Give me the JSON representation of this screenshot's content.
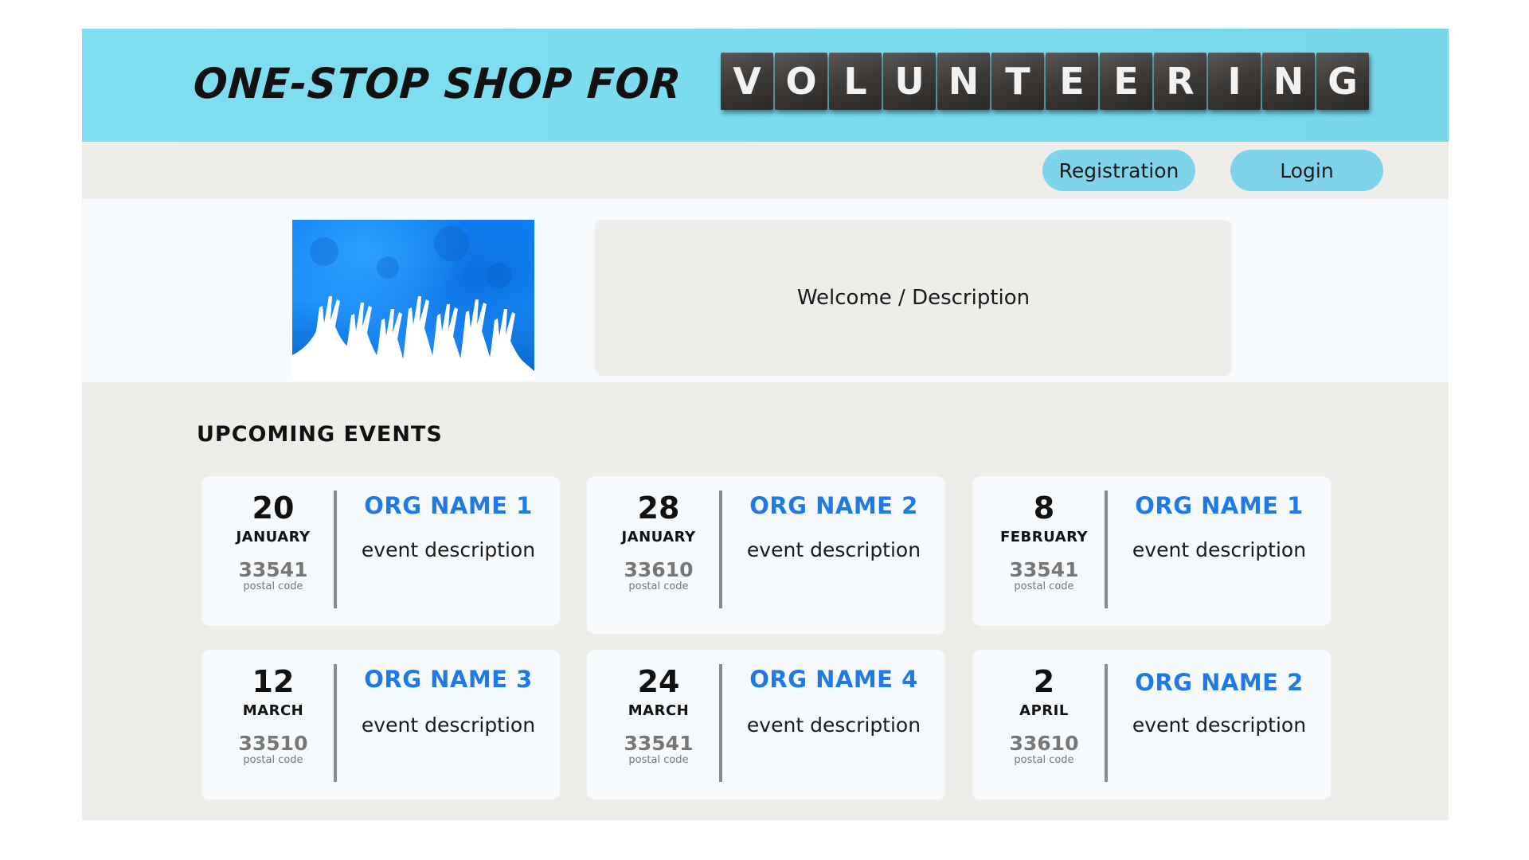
{
  "header": {
    "title": "ONE-STOP SHOP FOR",
    "tiles": [
      "V",
      "O",
      "L",
      "U",
      "N",
      "T",
      "E",
      "E",
      "R",
      "I",
      "N",
      "G"
    ]
  },
  "nav": {
    "registration_label": "Registration",
    "login_label": "Login"
  },
  "hero": {
    "welcome_text": "Welcome / Description"
  },
  "events": {
    "heading": "UPCOMING EVENTS",
    "postal_label": "postal code",
    "items": [
      {
        "day": "20",
        "month": "JANUARY",
        "postal": "33541",
        "postal_label": "postal code",
        "org": "ORG NAME 1",
        "description": "event description"
      },
      {
        "day": "28",
        "month": "JANUARY",
        "postal": "33610",
        "postal_label": "postal code",
        "org": "ORG NAME 2",
        "description": "event description"
      },
      {
        "day": "8",
        "month": "FEBRUARY",
        "postal": "33541",
        "postal_label": "postal code",
        "org": "ORG NAME 1",
        "description": "event description"
      },
      {
        "day": "12",
        "month": "MARCH",
        "postal": "33510",
        "postal_label": "postal code",
        "org": "ORG NAME 3",
        "description": "event description"
      },
      {
        "day": "24",
        "month": "MARCH",
        "postal": "33541",
        "postal_label": "postal code",
        "org": "ORG NAME 4",
        "description": "event description"
      },
      {
        "day": "2",
        "month": "APRIL",
        "postal": "33610",
        "postal_label": "postal code",
        "org": "ORG NAME 2",
        "description": "event description"
      }
    ]
  },
  "colors": {
    "banner": "#7adcef",
    "button": "#7fd3eb",
    "org_name": "#1d7ae6",
    "panel": "#efedea",
    "tile": "#3c3937"
  }
}
